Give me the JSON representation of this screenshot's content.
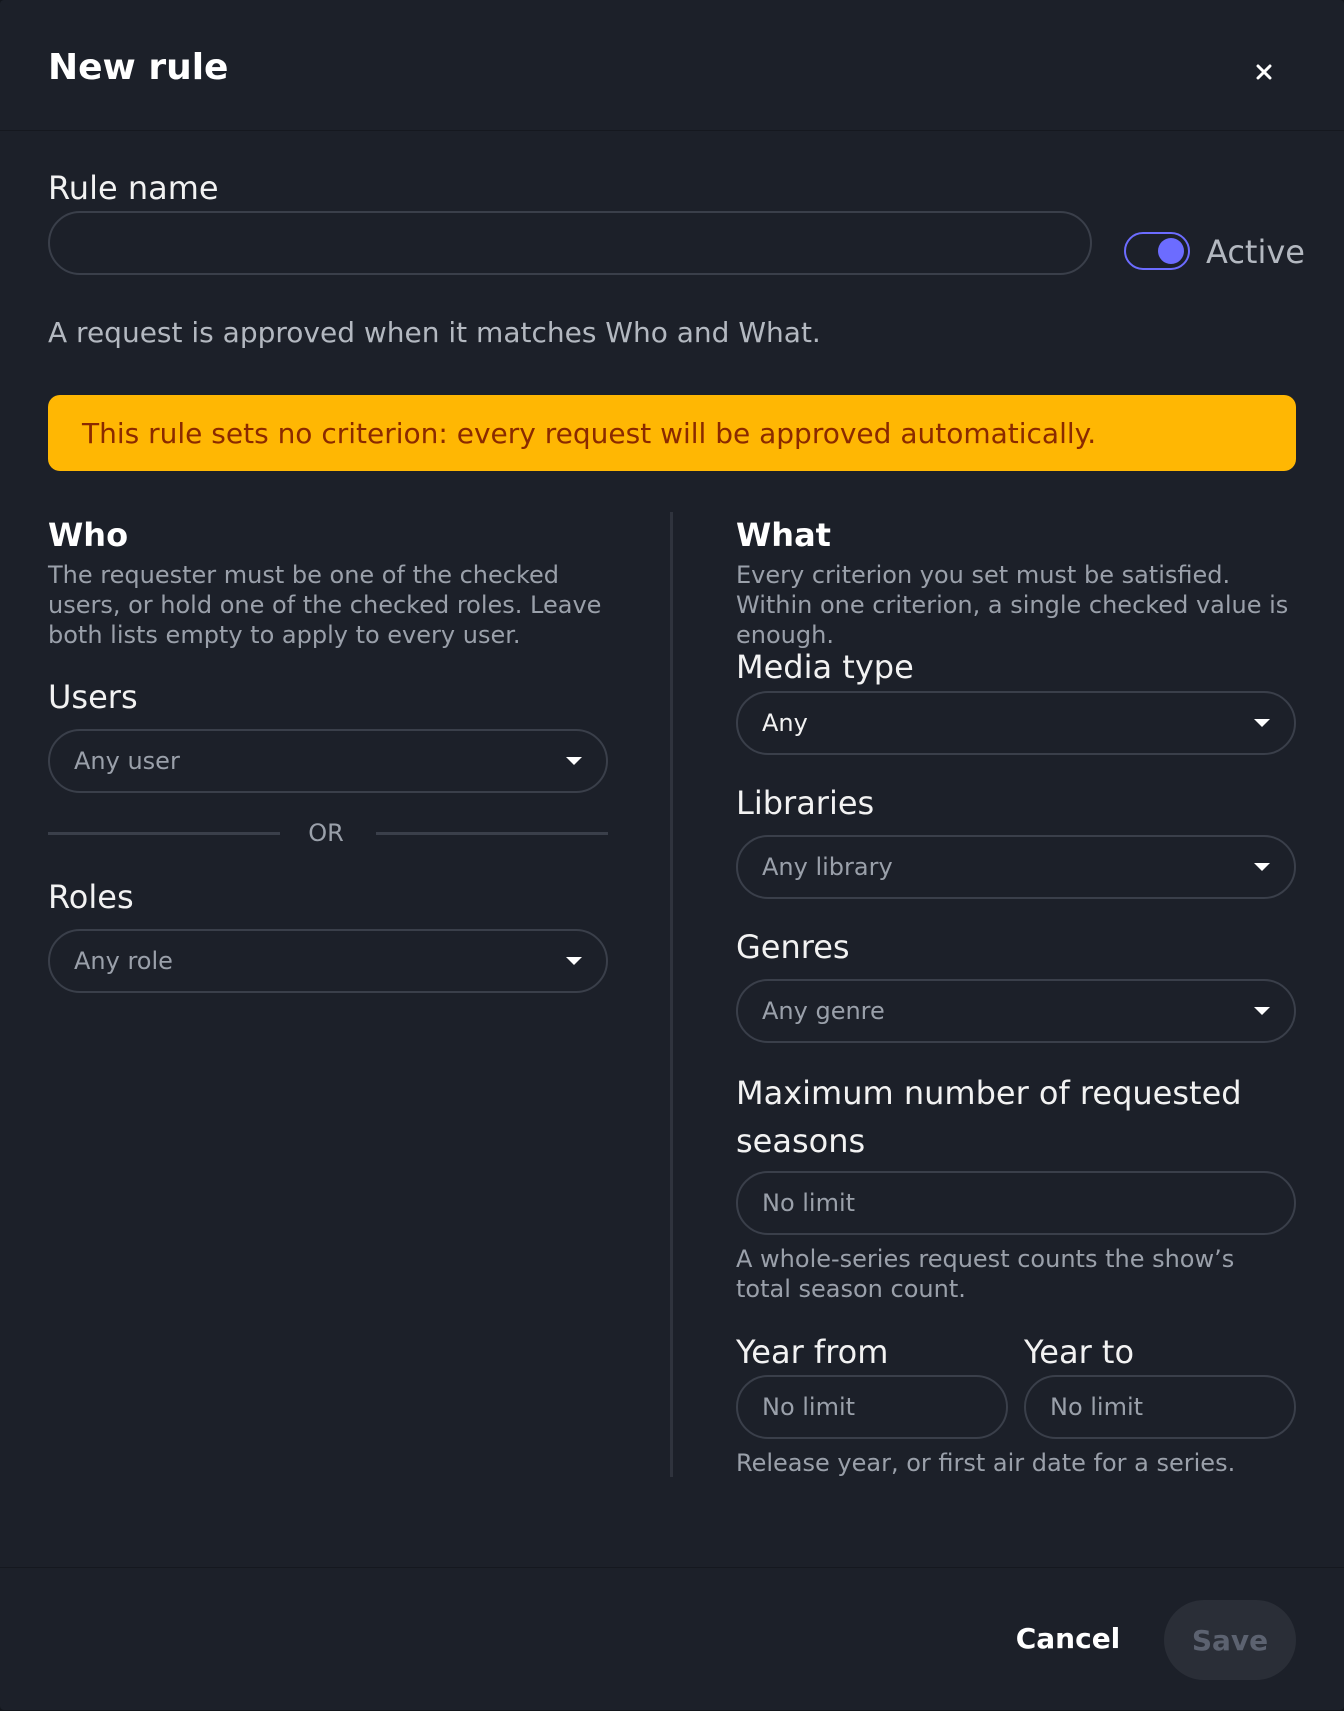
{
  "dialog": {
    "title": "New rule",
    "close_icon": "close-icon"
  },
  "rule_name": {
    "label": "Rule name",
    "value": "",
    "placeholder": ""
  },
  "active_toggle": {
    "label": "Active",
    "on": true,
    "accent": "#6c6cff"
  },
  "intro": "A request is approved when it matches Who and What.",
  "warning": {
    "text": "This rule sets no criterion: every request will be approved automatically.",
    "background": "#ffb703",
    "color": "#8a2a00"
  },
  "who": {
    "title": "Who",
    "description": "The requester must be one of the checked users, or hold one of the checked roles. Leave both lists empty to apply to every user.",
    "users": {
      "label": "Users",
      "value": "Any user"
    },
    "or_label": "OR",
    "roles": {
      "label": "Roles",
      "value": "Any role"
    }
  },
  "what": {
    "title": "What",
    "description": "Every criterion you set must be satisfied. Within one criterion, a single checked value is enough.",
    "media_type": {
      "label": "Media type",
      "value": "Any"
    },
    "libraries": {
      "label": "Libraries",
      "value": "Any library"
    },
    "genres": {
      "label": "Genres",
      "value": "Any genre"
    },
    "max_seasons": {
      "label": "Maximum number of requested seasons",
      "placeholder": "No limit",
      "help": "A whole-series request counts the show’s total season count."
    },
    "year_from": {
      "label": "Year from",
      "placeholder": "No limit"
    },
    "year_to": {
      "label": "Year to",
      "placeholder": "No limit"
    },
    "year_help": "Release year, or first air date for a series."
  },
  "footer": {
    "cancel_label": "Cancel",
    "save_label": "Save"
  }
}
